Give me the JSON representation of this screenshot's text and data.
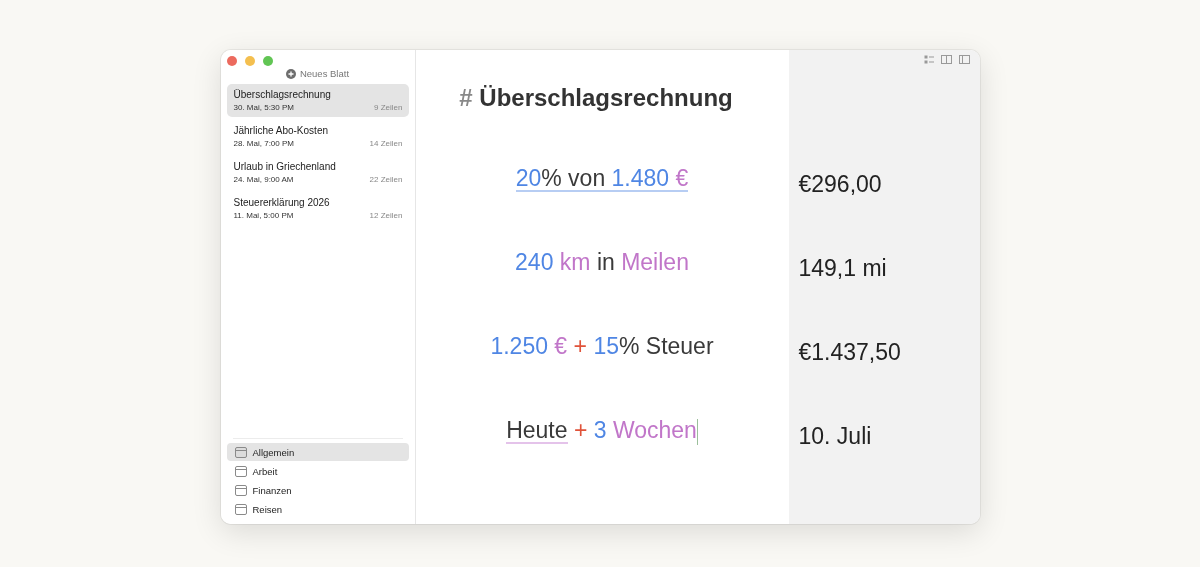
{
  "sidebar": {
    "new_sheet": "Neues Blatt",
    "sheets": [
      {
        "title": "Überschlagsrechnung",
        "date": "30. Mai, 5:30 PM",
        "lines": "9 Zeilen",
        "selected": true
      },
      {
        "title": "Jährliche Abo-Kosten",
        "date": "28. Mai, 7:00 PM",
        "lines": "14 Zeilen",
        "selected": false
      },
      {
        "title": "Urlaub in Griechenland",
        "date": "24. Mai, 9:00 AM",
        "lines": "22 Zeilen",
        "selected": false
      },
      {
        "title": "Steuererklärung 2026",
        "date": "11. Mai, 5:00 PM",
        "lines": "12 Zeilen",
        "selected": false
      }
    ],
    "folders": [
      {
        "name": "Allgemein",
        "selected": true
      },
      {
        "name": "Arbeit",
        "selected": false
      },
      {
        "name": "Finanzen",
        "selected": false
      },
      {
        "name": "Reisen",
        "selected": false
      }
    ]
  },
  "editor": {
    "heading_mark": "#",
    "heading": "Überschlagsrechnung",
    "lines": [
      {
        "cursor": false,
        "tokens": [
          {
            "kind": "number",
            "text": "20",
            "underlined": true
          },
          {
            "kind": "text",
            "text": "% von",
            "underlined": true,
            "join": true
          },
          {
            "kind": "number",
            "text": "1.480",
            "underlined": true
          },
          {
            "kind": "unit",
            "text": "€",
            "underlined": true
          }
        ],
        "result": "€296,00"
      },
      {
        "cursor": false,
        "tokens": [
          {
            "kind": "number",
            "text": "240",
            "underlined": false
          },
          {
            "kind": "unit",
            "text": "km",
            "underlined": false
          },
          {
            "kind": "text",
            "text": "in",
            "underlined": false
          },
          {
            "kind": "unit",
            "text": "Meilen",
            "underlined": false
          }
        ],
        "result": "149,1 mi"
      },
      {
        "cursor": false,
        "tokens": [
          {
            "kind": "number",
            "text": "1.250",
            "underlined": false
          },
          {
            "kind": "unit",
            "text": "€",
            "underlined": false
          },
          {
            "kind": "operator",
            "text": "+",
            "underlined": false
          },
          {
            "kind": "number",
            "text": "15",
            "underlined": false
          },
          {
            "kind": "text",
            "text": "% Steuer",
            "underlined": false,
            "join": true
          }
        ],
        "result": "€1.437,50"
      },
      {
        "cursor": true,
        "tokens": [
          {
            "kind": "keyword",
            "text": "Heute",
            "underlined": true
          },
          {
            "kind": "operator",
            "text": "+",
            "underlined": false
          },
          {
            "kind": "number",
            "text": "3",
            "underlined": false
          },
          {
            "kind": "unit",
            "text": "Wochen",
            "underlined": false
          }
        ],
        "result": "10. Juli"
      }
    ]
  }
}
